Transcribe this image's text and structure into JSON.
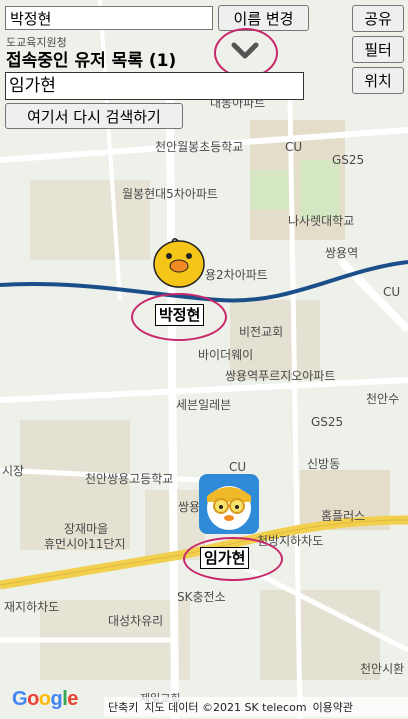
{
  "controls": {
    "name_input_value": "박정현",
    "rename_button": "이름 변경",
    "share_button": "공유",
    "filter_button": "필터",
    "location_button": "위치",
    "search_again_button": "여기서 다시 검색하기",
    "title": "접속중인 유저 목록 (1)",
    "user_list": [
      "임가현"
    ]
  },
  "markers": [
    {
      "name": "박정현",
      "icon": "sally-chick-avatar"
    },
    {
      "name": "임가현",
      "icon": "pororo-penguin-avatar"
    }
  ],
  "map_labels": {
    "top_left": "천안월봉초등학교",
    "apartment_1": "월봉현대5차아파트",
    "cu_1": "CU",
    "gs25_1": "GS25",
    "university": "나사렛대학교",
    "station": "쌍용역",
    "cu_2": "CU",
    "apartment_2": "용2차아파트",
    "church": "비전교회",
    "bidaway": "바이더웨이",
    "apartment_3": "쌍용역푸르지오아파트",
    "selvenil": "세븐일레븐",
    "gs25_2": "GS25",
    "cheonan_su": "천안수",
    "siljang": "시장",
    "school2": "천안쌍용고등학교",
    "cu_3": "CU",
    "sinbangdong": "신방동",
    "apartment_4": "장재마을",
    "apartment_4b": "휴먼시아11단지",
    "homeplus": "홈플러스",
    "underpass_1": "천방지하차도",
    "underpass_2": "재지하차도",
    "sk": "SK충전소",
    "glass": "대성차유리",
    "cheonan_city": "천안시환",
    "top_banner": "도교육지원청",
    "sanyong_partial": "쌍용",
    "apt_top": "대동아파트",
    "bottom_partial": "제일교회"
  },
  "footer": {
    "google": "Google",
    "shortcut": "단축키",
    "map_data": "지도 데이터 ©2021 SK telecom",
    "terms": "이용약관"
  },
  "colors": {
    "accent_circle": "#c8286a",
    "rail": "#1b4f8a",
    "road_yellow": "#f2cf4d"
  }
}
